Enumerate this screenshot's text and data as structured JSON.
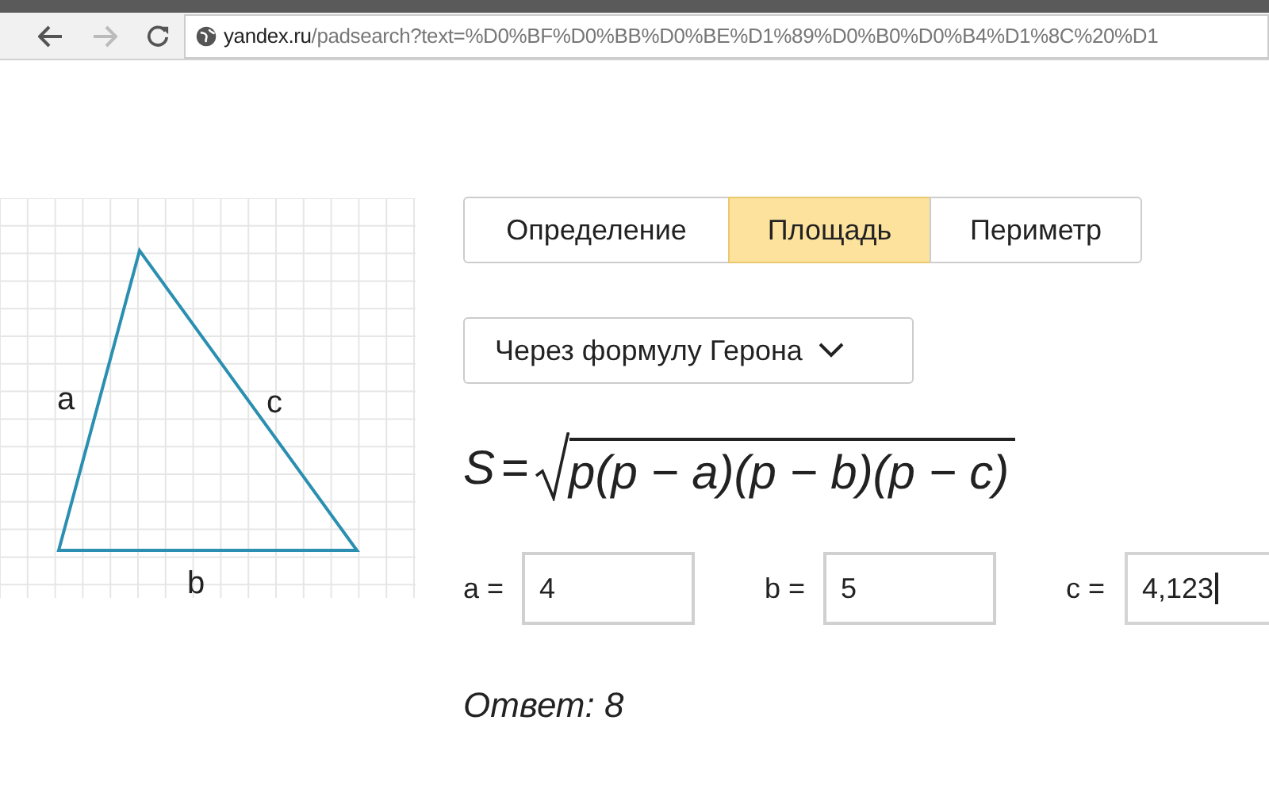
{
  "browser": {
    "url_host": "yandex.ru",
    "url_path": "/padsearch?text=%D0%BF%D0%BB%D0%BE%D1%89%D0%B0%D0%B4%D1%8C%20%D1"
  },
  "figure": {
    "labels": [
      "a",
      "c",
      "b"
    ]
  },
  "tabs": [
    {
      "label": "Определение",
      "selected": false
    },
    {
      "label": "Площадь",
      "selected": true
    },
    {
      "label": "Периметр",
      "selected": false
    }
  ],
  "method_dropdown": {
    "value": "Через формулу Герона"
  },
  "formula": {
    "lhs": "S",
    "equals": "=",
    "radicand": "p(p − a)(p − b)(p − c)"
  },
  "inputs": [
    {
      "label": "a =",
      "value": "4",
      "focused": false
    },
    {
      "label": "b =",
      "value": "5",
      "focused": false
    },
    {
      "label": "c =",
      "value": "4,123",
      "focused": true
    }
  ],
  "answer": "Ответ: 8"
}
